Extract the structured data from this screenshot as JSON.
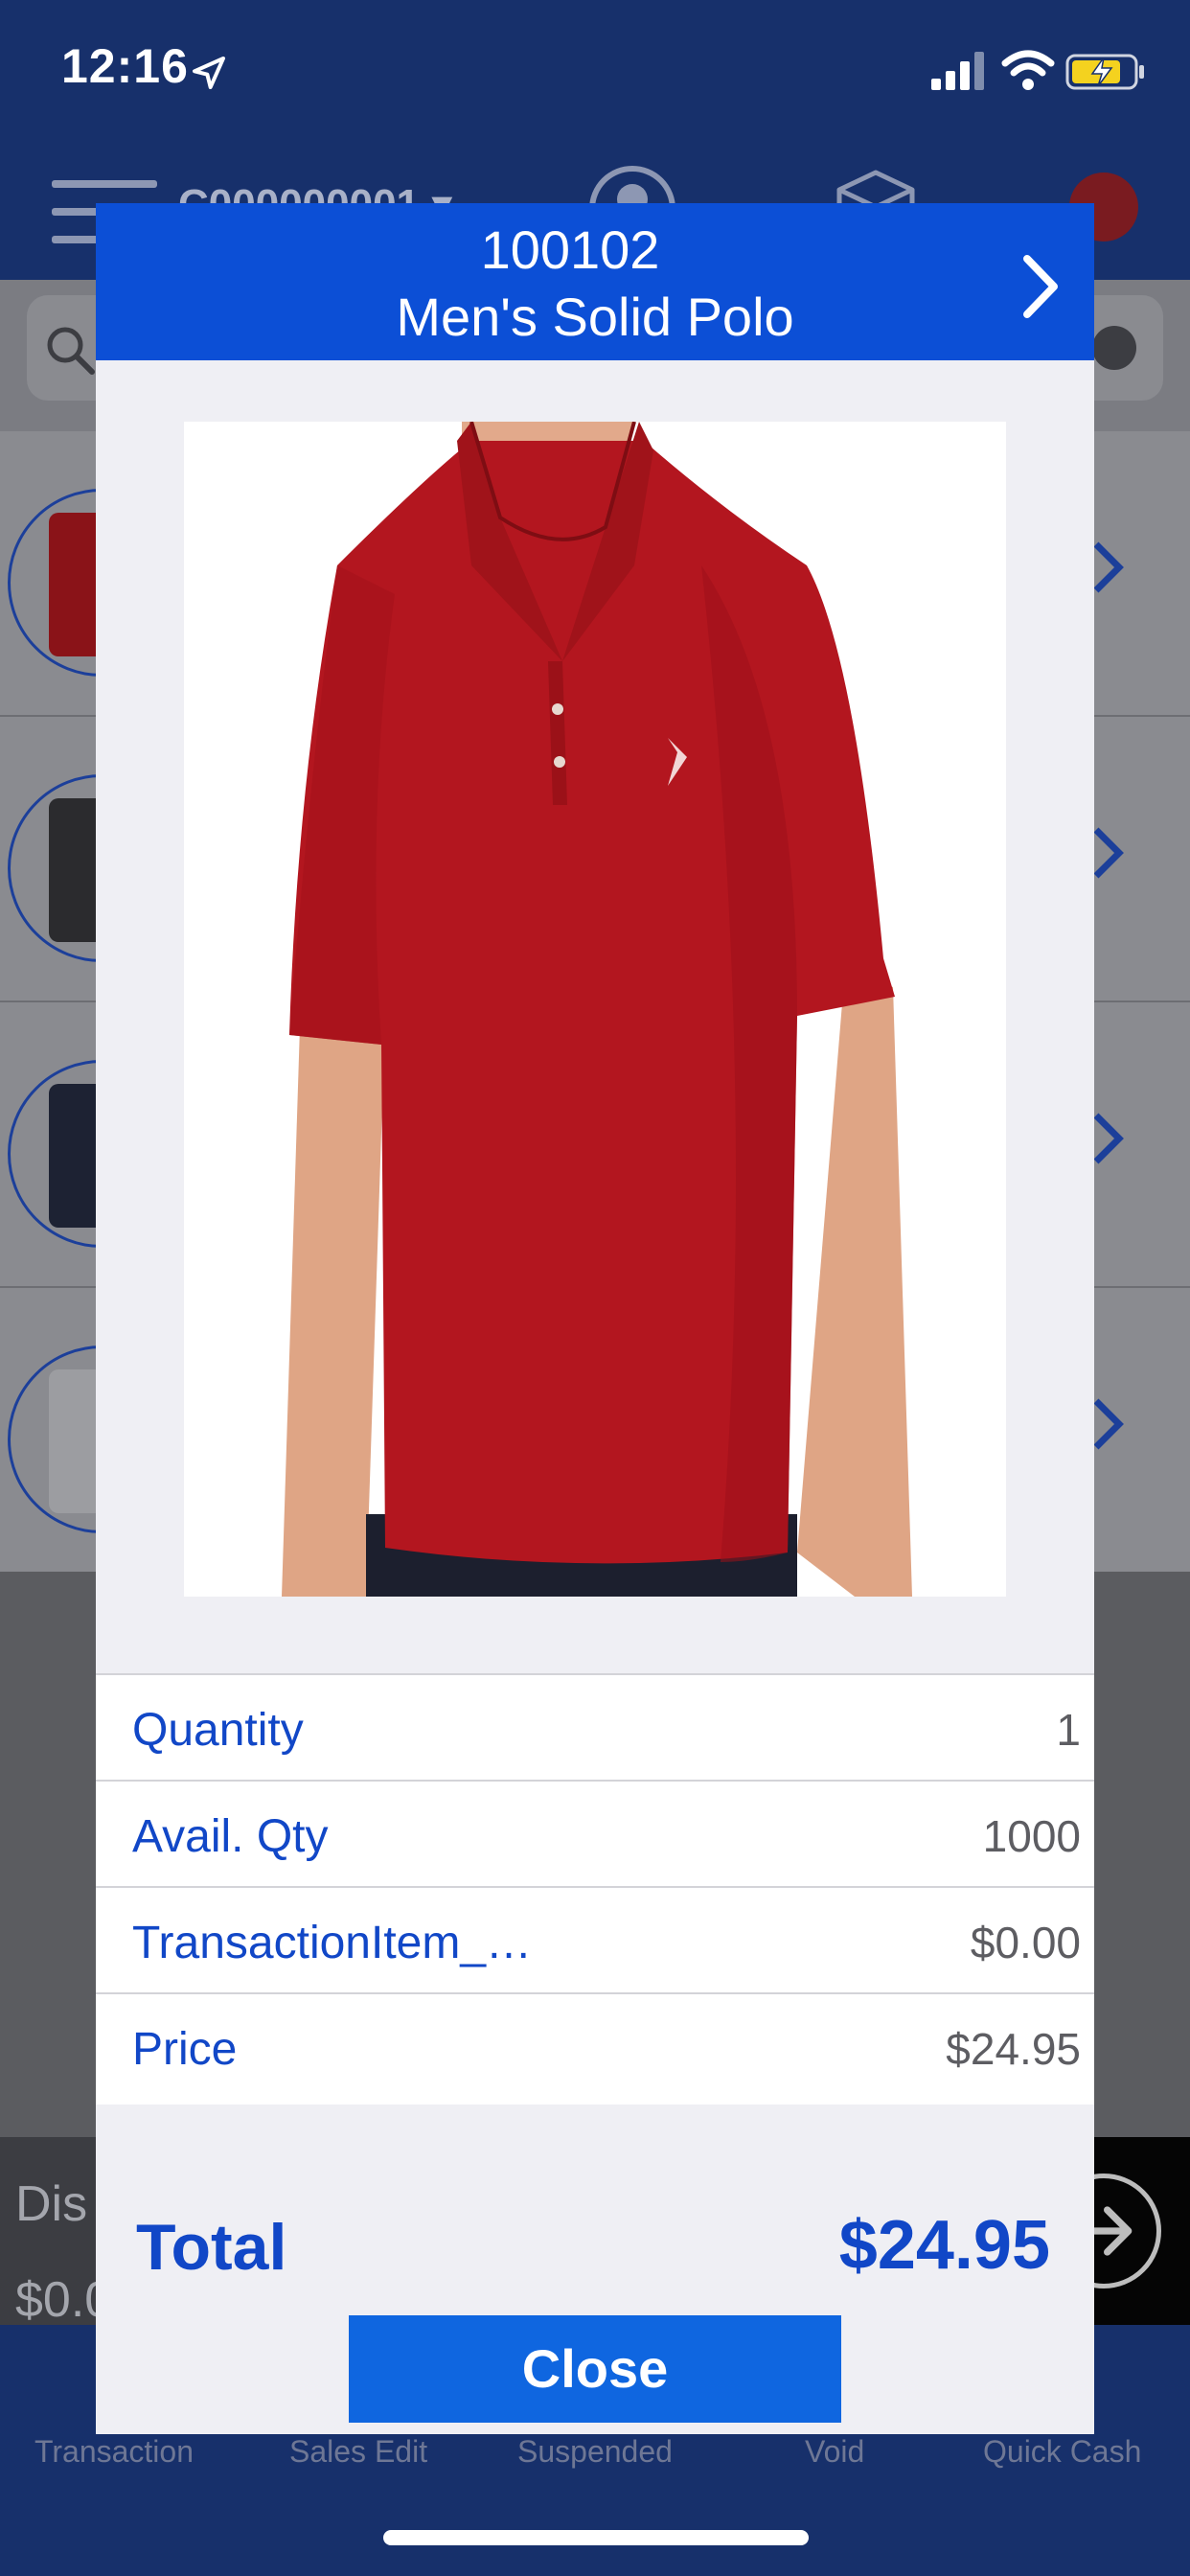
{
  "status_bar": {
    "time": "12:16"
  },
  "header": {
    "code": "C000000001 ▾"
  },
  "background_tabs": [
    {
      "label": "Transaction"
    },
    {
      "label": "Sales Edit"
    },
    {
      "label": "Suspended"
    },
    {
      "label": "Void"
    },
    {
      "label": "Quick Cash"
    }
  ],
  "discount_bar": {
    "label": "Dis",
    "amount": "$0.0"
  },
  "modal": {
    "sku": "100102",
    "name": "Men's Solid Polo",
    "details": [
      {
        "label": "Quantity",
        "value": "1"
      },
      {
        "label": "Avail. Qty",
        "value": "1000"
      },
      {
        "label": "TransactionItem_…",
        "value": "$0.00"
      },
      {
        "label": "Price",
        "value": "$24.95"
      }
    ],
    "total_label": "Total",
    "total_value": "$24.95",
    "close_label": "Close"
  },
  "colors": {
    "primary_blue": "#0c4fd6",
    "text_blue": "#1147c7",
    "header_navy": "#17306b",
    "shirt_red": "#b3161f"
  }
}
